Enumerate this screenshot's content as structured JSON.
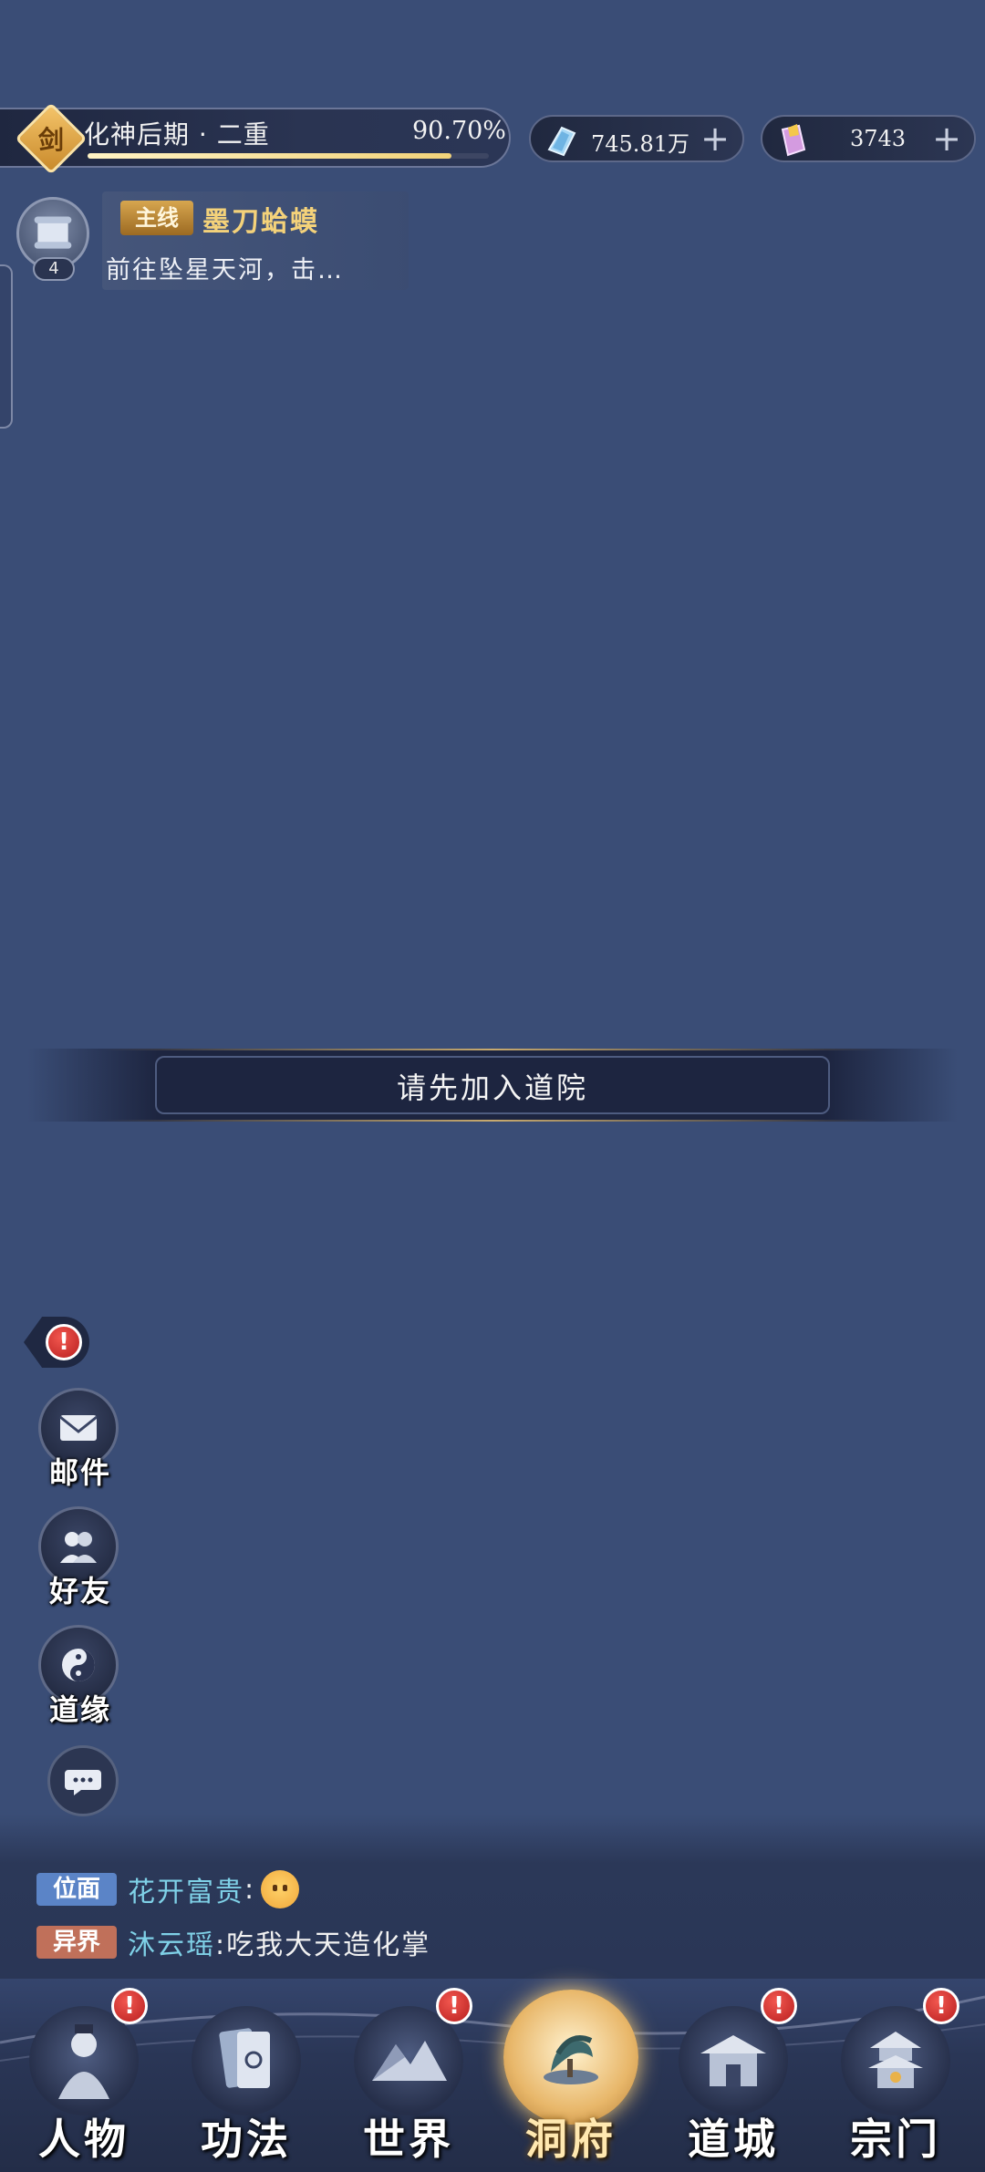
{
  "status": {
    "realm_emblem": "剑",
    "realm_label": "化神后期 · 二重",
    "realm_percent": "90.70%",
    "realm_progress": 0.907
  },
  "currencies": [
    {
      "icon": "jade-crystal-icon",
      "value": "745.81万",
      "color": "#9fd2f2"
    },
    {
      "icon": "gold-ticket-icon",
      "value": "3743",
      "color": "#e7b8f0"
    }
  ],
  "quest": {
    "avatar_count": "4",
    "tag": "主线",
    "title": "墨刀蛤蟆",
    "description": "前往坠星天河，击…"
  },
  "banner": {
    "text": "请先加入道院"
  },
  "side_menu": [
    {
      "id": "mail",
      "label": "邮件",
      "icon": "envelope-icon"
    },
    {
      "id": "friends",
      "label": "好友",
      "icon": "friends-icon"
    },
    {
      "id": "fate",
      "label": "道缘",
      "icon": "yin-yang-icon"
    }
  ],
  "chat": {
    "lines": [
      {
        "channel": "位面",
        "channel_color": "#5b84c7",
        "sender": "花开富贵",
        "message": ":"
      },
      {
        "channel": "异界",
        "channel_color": "#c0705a",
        "sender": "沐云瑶",
        "message": ":吃我大天造化掌"
      }
    ]
  },
  "nav": {
    "items": [
      {
        "label": "人物",
        "icon": "character-icon",
        "badge": true
      },
      {
        "label": "功法",
        "icon": "scroll-cards-icon",
        "badge": false
      },
      {
        "label": "世界",
        "icon": "world-map-icon",
        "badge": true
      },
      {
        "label": "洞府",
        "icon": "cave-dwelling-icon",
        "badge": false,
        "active": true
      },
      {
        "label": "道城",
        "icon": "city-gate-icon",
        "badge": true
      },
      {
        "label": "宗门",
        "icon": "sect-pagoda-icon",
        "badge": true
      }
    ],
    "badge_glyph": "!"
  },
  "colors": {
    "background": "#3a4d76",
    "accent_gold": "#f4d27a",
    "badge_red": "#d93a33"
  }
}
